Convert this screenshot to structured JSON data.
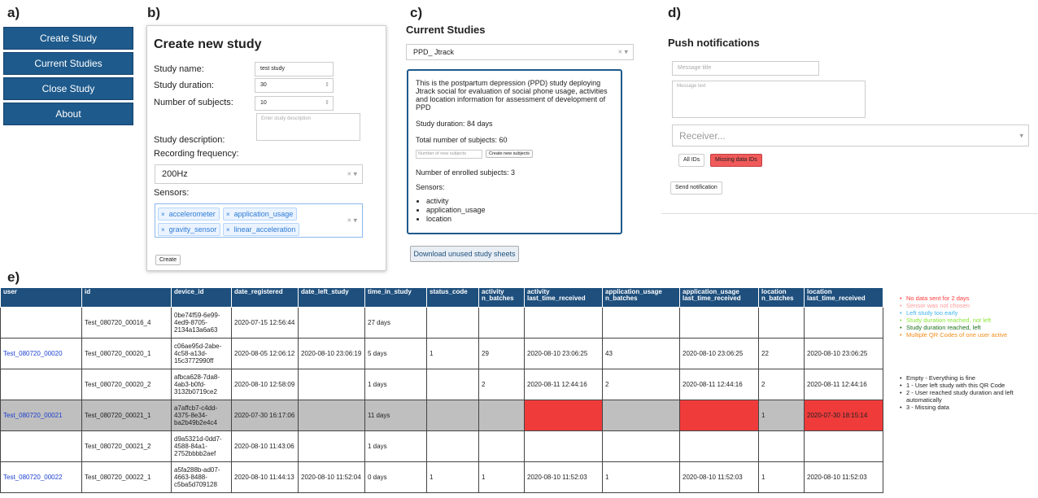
{
  "labels": {
    "a": "a)",
    "b": "b)",
    "c": "c)",
    "d": "d)",
    "e": "e)"
  },
  "nav": {
    "items": [
      {
        "label": "Create Study"
      },
      {
        "label": "Current Studies"
      },
      {
        "label": "Close Study"
      },
      {
        "label": "About"
      }
    ]
  },
  "create": {
    "title": "Create new study",
    "name_label": "Study name:",
    "name_value": "test study",
    "duration_label": "Study duration:",
    "duration_value": "30",
    "subjects_label": "Number of subjects:",
    "subjects_value": "10",
    "description_label": "Study description:",
    "description_placeholder": "Enter study description",
    "frequency_label": "Recording frequency:",
    "frequency_value": "200Hz",
    "sensors_label": "Sensors:",
    "sensors": [
      "accelerometer",
      "application_usage",
      "gravity_sensor",
      "linear_acceleration"
    ],
    "create_button": "Create"
  },
  "current": {
    "title": "Current Studies",
    "selected_study": "PPD_ Jtrack",
    "description": "This is the postpartum depression (PPD) study deploying  Jtrack social for evaluation of social phone usage, activities and location information for assessment of development of PPD",
    "duration": "Study duration: 84 days",
    "total_subjects": "Total number of subjects: 60",
    "new_subjects_placeholder": "Number of new subjects",
    "create_subjects_button": "Create new subjects",
    "enrolled": "Number of enrolled subjects: 3",
    "sensors_label": "Sensors:",
    "sensors": [
      "activity",
      "application_usage",
      "location"
    ],
    "download_button": "Download unused study sheets"
  },
  "push": {
    "title": "Push notifications",
    "message_title_placeholder": "Message title",
    "message_text_placeholder": "Message text",
    "receiver_placeholder": "Receiver...",
    "all_ids": "All IDs",
    "missing_ids": "Missing data IDs",
    "send": "Send notification"
  },
  "table": {
    "headers": [
      "user",
      "id",
      "device_id",
      "date_registered",
      "date_left_study",
      "time_in_study",
      "status_code",
      "activity n_batches",
      "activity last_time_received",
      "application_usage n_batches",
      "application_usage last_time_received",
      "location n_batches",
      "location last_time_received"
    ],
    "rows": [
      {
        "user": "",
        "id": "Test_080720_00016_4",
        "device_id": "0be74f59-6e99-4ed9-8705-2134a13a6a63",
        "date_registered": "2020-07-15 12:56:44",
        "date_left_study": "",
        "time_in_study": "27 days",
        "status_code": "",
        "activity_n": "",
        "activity_last": "",
        "app_n": "",
        "app_last": "",
        "loc_n": "",
        "loc_last": ""
      },
      {
        "user": "Test_080720_00020",
        "id": "Test_080720_00020_1",
        "device_id": "c06ae95d-2abe-4c58-a13d-15c3772990ff",
        "date_registered": "2020-08-05 12:06:12",
        "date_left_study": "2020-08-10 23:06:19",
        "time_in_study": "5 days",
        "status_code": "1",
        "activity_n": "29",
        "activity_last": "2020-08-10 23:06:25",
        "app_n": "43",
        "app_last": "2020-08-10 23:06:25",
        "loc_n": "22",
        "loc_last": "2020-08-10 23:06:25"
      },
      {
        "user": "",
        "id": "Test_080720_00020_2",
        "device_id": "afbca628-7da8-4ab3-b0fd-3132b0719ce2",
        "date_registered": "2020-08-10 12:58:09",
        "date_left_study": "",
        "time_in_study": "1 days",
        "status_code": "",
        "activity_n": "2",
        "activity_last": "2020-08-11 12:44:16",
        "app_n": "2",
        "app_last": "2020-08-11 12:44:16",
        "loc_n": "2",
        "loc_last": "2020-08-11 12:44:16"
      },
      {
        "user": "Test_080720_00021",
        "id": "Test_080720_00021_1",
        "device_id": "a7affcb7-c4dd-4375-8e34-ba2b49b2e4c4",
        "date_registered": "2020-07-30 16:17:06",
        "date_left_study": "",
        "time_in_study": "11 days",
        "status_code": "",
        "activity_n": "",
        "activity_last": "",
        "app_n": "",
        "app_last": "",
        "loc_n": "1",
        "loc_last": "2020-07-30 18:15:14"
      },
      {
        "user": "",
        "id": "Test_080720_00021_2",
        "device_id": "d9a5321d-0dd7-4588-84a1-2752bbbb2aef",
        "date_registered": "2020-08-10 11:43:06",
        "date_left_study": "",
        "time_in_study": "1 days",
        "status_code": "",
        "activity_n": "",
        "activity_last": "",
        "app_n": "",
        "app_last": "",
        "loc_n": "",
        "loc_last": ""
      },
      {
        "user": "Test_080720_00022",
        "id": "Test_080720_00022_1",
        "device_id": "a5fa288b-ad07-4663-8488-c5ba5d709128",
        "date_registered": "2020-08-10 11:44:13",
        "date_left_study": "2020-08-10 11:52:04",
        "time_in_study": "0 days",
        "status_code": "1",
        "activity_n": "1",
        "activity_last": "2020-08-10 11:52:03",
        "app_n": "1",
        "app_last": "2020-08-10 11:52:03",
        "loc_n": "1",
        "loc_last": "2020-08-10 11:52:03"
      }
    ]
  },
  "legend_colors": {
    "items": [
      {
        "text": "No data sent for 2 days",
        "color": "#ff3b3b"
      },
      {
        "text": "Sensor was not chosen",
        "color": "#ff9a9a"
      },
      {
        "text": "Left study too early",
        "color": "#3eb4ec"
      },
      {
        "text": "Study duration reached, not left",
        "color": "#8ae63a"
      },
      {
        "text": "Study duration reached, left",
        "color": "#1b6f1b"
      },
      {
        "text": "Multiple QR Codes of one user active",
        "color": "#f28c1a"
      }
    ]
  },
  "legend_codes": {
    "items": [
      "Empty - Everything is fine",
      "1 - User left study with this QR Code",
      "2 - User reached study duration and left automatically",
      "3 - Missing data"
    ]
  }
}
